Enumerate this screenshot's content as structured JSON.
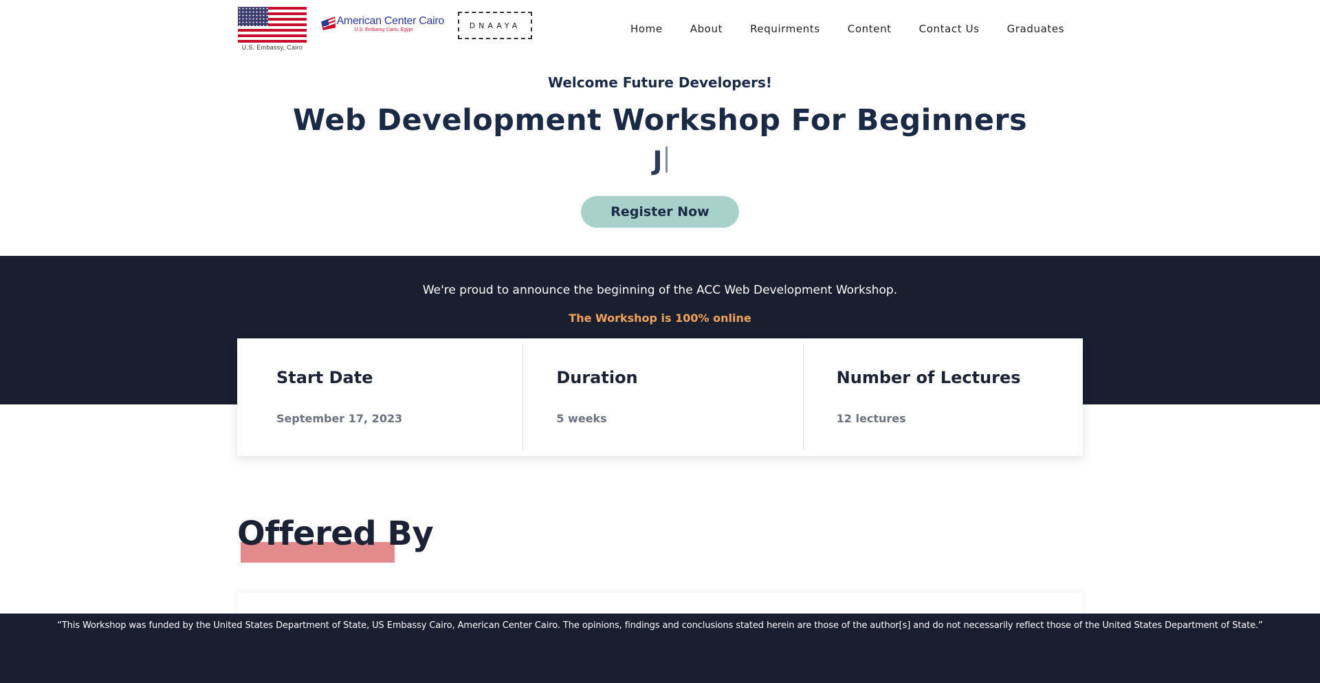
{
  "nav": {
    "logos": {
      "embassy_label": "U.S. Embassy, Cairo",
      "acc_name": "American Center Cairo",
      "acc_subtitle": "U.S. Embassy Cairo, Egypt",
      "dnaaya": "DNAAYA"
    },
    "items": [
      {
        "label": "Home"
      },
      {
        "label": "About"
      },
      {
        "label": "Requirments"
      },
      {
        "label": "Content"
      },
      {
        "label": "Contact Us"
      },
      {
        "label": "Graduates"
      }
    ]
  },
  "hero": {
    "welcome": "Welcome Future Developers!",
    "title": "Web Development Workshop For Beginners",
    "typed_text": "J",
    "register_label": "Register Now"
  },
  "band": {
    "announcement": "We're proud to announce the beginning of the ACC Web Development Workshop.",
    "online_note": "The Workshop is 100% online"
  },
  "info": [
    {
      "title": "Start Date",
      "value": "September 17, 2023"
    },
    {
      "title": "Duration",
      "value": "5 weeks"
    },
    {
      "title": "Number of Lectures",
      "value": "12 lectures"
    }
  ],
  "offered": {
    "heading": "Offered By"
  },
  "footer": {
    "disclaimer": "“This Workshop was funded by the United States Department of State, US Embassy Cairo, American Center Cairo. The opinions, findings and conclusions stated herein are those of the author[s] and do not necessarily reflect those of the United States Department of State.”"
  },
  "colors": {
    "navy": "#1b2a44",
    "dark_band": "#1a1f30",
    "register_bg": "#a9d1cc",
    "online_orange": "#f3a35a",
    "highlight_pink": "#e38a8c"
  }
}
